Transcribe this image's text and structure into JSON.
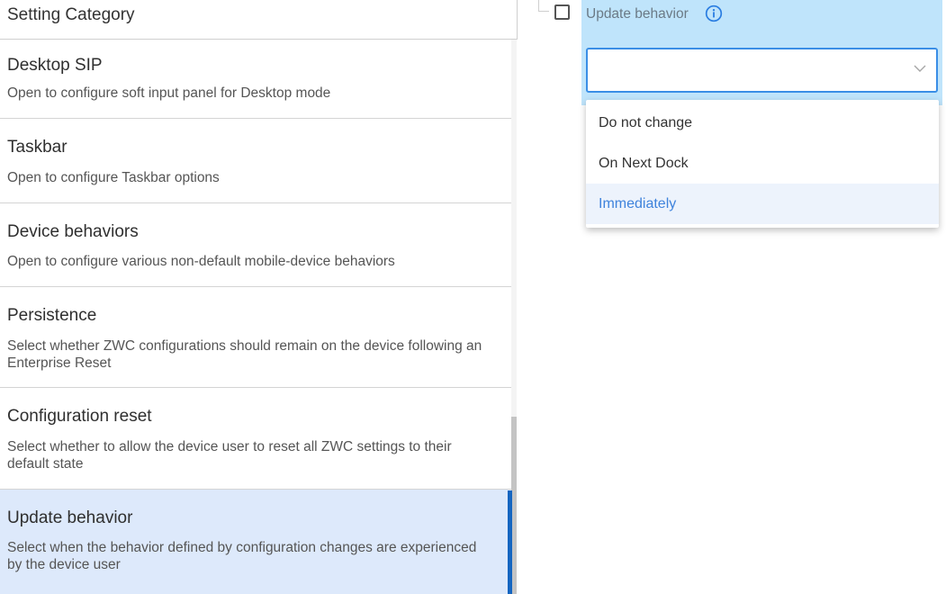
{
  "left_panel": {
    "header": "Setting Category",
    "items": [
      {
        "title": "Desktop SIP",
        "desc": "Open to configure soft input panel for Desktop mode"
      },
      {
        "title": "Taskbar",
        "desc": "Open to configure Taskbar options"
      },
      {
        "title": "Device behaviors",
        "desc": "Open to configure various non-default mobile-device behaviors"
      },
      {
        "title": "Persistence",
        "desc": "Select whether ZWC configurations should remain on the device following an Enterprise Reset"
      },
      {
        "title": "Configuration reset",
        "desc": "Select whether to allow the device user to reset all ZWC settings to their default state"
      },
      {
        "title": "Update behavior",
        "desc": "Select when the behavior defined by configuration changes are experienced by the device user"
      }
    ],
    "active_index": 5
  },
  "setting": {
    "label": "Update behavior",
    "info_icon": "info-circle-icon",
    "checkbox_checked": false,
    "select_value": "",
    "dropdown_options": [
      "Do not change",
      "On Next Dock",
      "Immediately"
    ],
    "hovered_option": "Immediately"
  },
  "colors": {
    "accent": "#1565c0",
    "active_item_bg": "#dde9fb",
    "setting_highlight": "#bfe4fb",
    "select_border": "#3a8ee6",
    "option_highlight_text": "#3f83dc"
  }
}
